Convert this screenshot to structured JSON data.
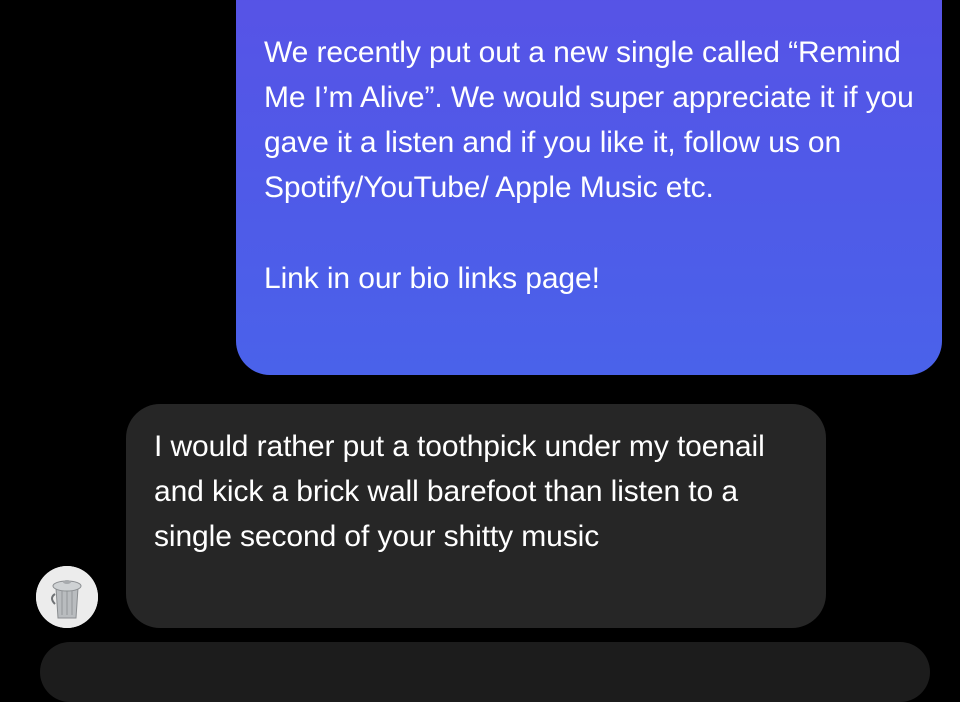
{
  "conversation": {
    "sent_message": {
      "paragraph_1": "We recently put out a new single called “Remind Me I’m Alive”. We would super appreciate it if you gave it a listen and if you like it, follow us on Spotify/YouTube/ Apple Music etc.",
      "paragraph_2": "Link in our bio links page!"
    },
    "received_message": {
      "text": "I would rather put a toothpick under my toenail and kick a brick wall barefoot than listen to a single second of your shitty music"
    },
    "avatar": {
      "icon": "trash-can-avatar-icon"
    }
  },
  "colors": {
    "background": "#000000",
    "sent_bubble_top": "#5852e6",
    "sent_bubble_bottom": "#4a62ea",
    "received_bubble": "#262626",
    "text": "#ffffff"
  }
}
